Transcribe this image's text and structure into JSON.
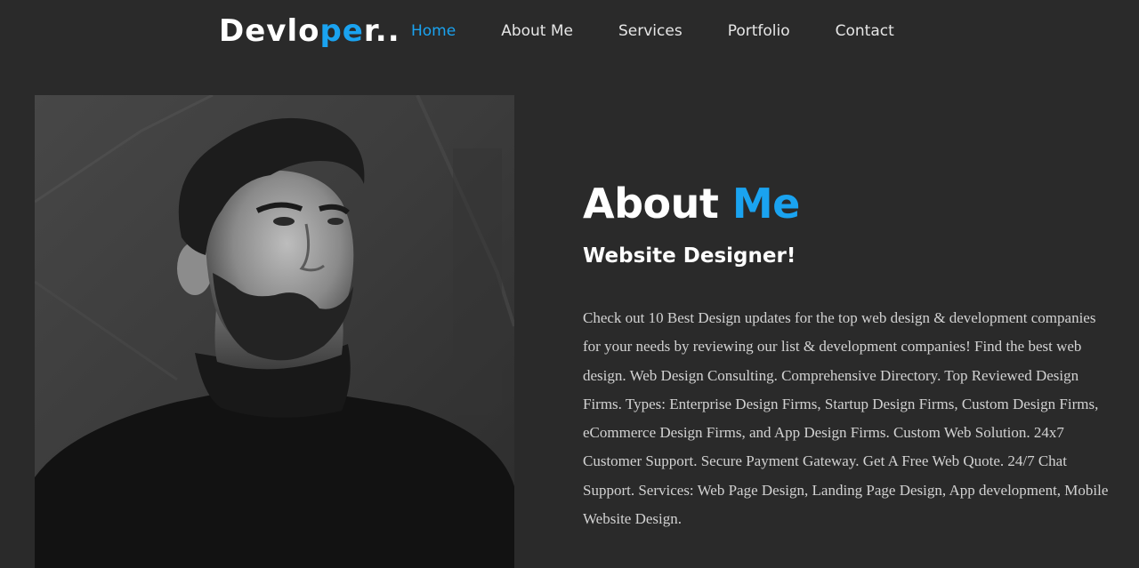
{
  "header": {
    "logo": {
      "part1": "Devlo",
      "part2": "pe",
      "part3": "r.."
    },
    "nav": [
      {
        "label": "Home",
        "active": true
      },
      {
        "label": "About Me",
        "active": false
      },
      {
        "label": "Services",
        "active": false
      },
      {
        "label": "Portfolio",
        "active": false
      },
      {
        "label": "Contact",
        "active": false
      }
    ]
  },
  "about": {
    "title_main": "About ",
    "title_accent": "Me",
    "subtitle": "Website Designer!",
    "body": "Check out 10 Best Design updates for the top web design & development companies for your needs by reviewing our list & development companies! Find the best web design. Web Design Consulting. Comprehensive Directory. Top Reviewed Design Firms. Types: Enterprise Design Firms, Startup Design Firms, Custom Design Firms, eCommerce Design Firms, and App Design Firms. Custom Web Solution. 24x7 Customer Support. Secure Payment Gateway. Get A Free Web Quote. 24/7 Chat Support. Services: Web Page Design, Landing Page Design, App development, Mobile Website Design."
  },
  "colors": {
    "background": "#2a2a2a",
    "accent": "#1aa3f0",
    "text": "#ffffff",
    "body_text": "#d2d2d2"
  }
}
